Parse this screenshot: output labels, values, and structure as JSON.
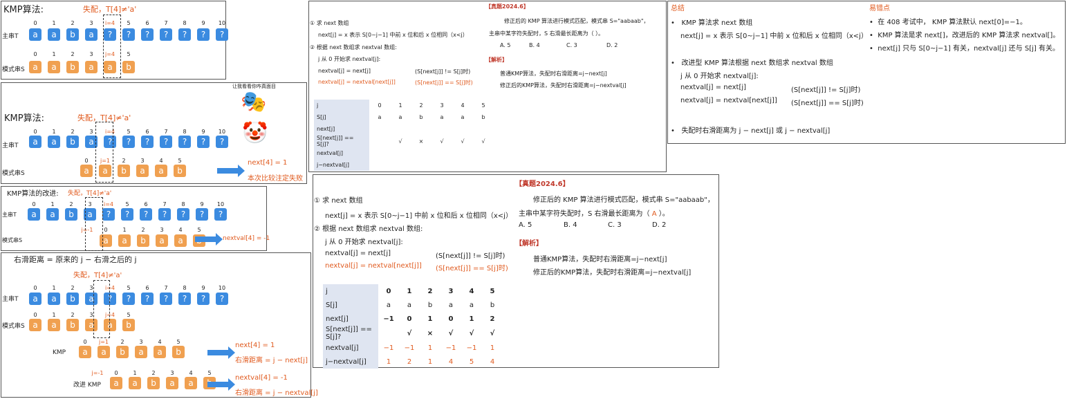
{
  "p1": {
    "title": "KMP算法:",
    "mismatch": "失配，T[4]≠'a'",
    "label_main": "主串T",
    "label_pattern": "模式串S",
    "idx_main": [
      "0",
      "1",
      "2",
      "3",
      "i=4",
      "5",
      "6",
      "7",
      "8",
      "9",
      "10"
    ],
    "main": [
      "a",
      "a",
      "b",
      "a",
      "?",
      "?",
      "?",
      "?",
      "?",
      "?",
      "?"
    ],
    "idx_pat": [
      "0",
      "1",
      "2",
      "3",
      "j=4",
      "5"
    ],
    "pattern": [
      "a",
      "a",
      "b",
      "a",
      "a",
      "b"
    ]
  },
  "p2": {
    "title": "KMP算法:",
    "mismatch": "失配，T[4]≠'a'",
    "caption": "让我看看你咋真面目",
    "label_main": "主串T",
    "label_pattern": "模式串S",
    "idx_main": [
      "0",
      "1",
      "2",
      "3",
      "i=4",
      "5",
      "6",
      "7",
      "8",
      "9",
      "10"
    ],
    "main": [
      "a",
      "a",
      "b",
      "a",
      "?",
      "?",
      "?",
      "?",
      "?",
      "?",
      "?"
    ],
    "idx_pat": [
      "0",
      "j=1",
      "2",
      "3",
      "4",
      "5"
    ],
    "pattern": [
      "a",
      "a",
      "b",
      "a",
      "a",
      "b"
    ],
    "note1": "next[4] = 1",
    "note2": "本次比较注定失败"
  },
  "p3": {
    "title": "KMP算法的改进:",
    "mismatch": "失配，T[4]≠'a'",
    "label_main": "主串T",
    "label_pattern": "模式串S",
    "idx_main": [
      "0",
      "1",
      "2",
      "3",
      "i=4",
      "5",
      "6",
      "7",
      "8",
      "9",
      "10"
    ],
    "main": [
      "a",
      "a",
      "b",
      "a",
      "?",
      "?",
      "?",
      "?",
      "?",
      "?",
      "?"
    ],
    "idx_pat": [
      "j=-1",
      "0",
      "1",
      "2",
      "3",
      "4",
      "5"
    ],
    "pattern": [
      "a",
      "a",
      "b",
      "a",
      "a",
      "b"
    ],
    "note": "nextval[4] = -1"
  },
  "p4": {
    "title": "右滑距离 = 原来的 j − 右滑之后的 j",
    "mismatch": "失配，T[4]≠'a'",
    "label_main": "主串T",
    "label_pattern": "模式串S",
    "idx_main": [
      "0",
      "1",
      "2",
      "3",
      "i=4",
      "5",
      "6",
      "7",
      "8",
      "9",
      "10"
    ],
    "main": [
      "a",
      "a",
      "b",
      "a",
      "?",
      "?",
      "?",
      "?",
      "?",
      "?",
      "?"
    ],
    "idx_pat": [
      "0",
      "1",
      "2",
      "3",
      "j=4",
      "5"
    ],
    "pattern": [
      "a",
      "a",
      "b",
      "a",
      "a",
      "b"
    ],
    "kmp_label": "KMP",
    "idx_kmp": [
      "0",
      "j=1",
      "2",
      "3",
      "4",
      "5"
    ],
    "kmp_note1": "next[4] = 1",
    "kmp_note2": "右滑距离 = j − next[j]",
    "improved_label": "改进 KMP",
    "idx_imp": [
      "j=-1",
      "0",
      "1",
      "2",
      "3",
      "4",
      "5"
    ],
    "imp_note1": "nextval[4] = -1",
    "imp_note2": "右滑距离 = j − nextval[j]"
  },
  "q": {
    "step1": "① 求 next 数组",
    "step1_def": "next[j] = x 表示 S[0~j−1] 中前 x 位和后 x 位相同（x<j）",
    "step2": "② 根据 next 数组求 nextval 数组:",
    "step2_sub": "j 从 0 开始求 nextval[j]:",
    "f1": "nextval[j] = next[j]",
    "c1": "(S[next[j]] != S[j]时)",
    "f2": "nextval[j] = nextval[next[j]]",
    "c2": "(S[next[j]] == S[j]时)",
    "tag": "【真题2024.6】",
    "question": "修正后的 KMP 算法进行模式匹配，模式串 S=\"aabaab\"，",
    "question2": "主串中某字符失配时，S 右滑最长距离为（    ）。",
    "options": [
      "A. 5",
      "B.  4",
      "C. 3",
      "D. 2"
    ],
    "analysis": "【解析】",
    "a1": "普通KMP算法，失配时右滑距离=j−next[j]",
    "a2": "修正后的KMP算法，失配时右滑距离=j−nextval[j]",
    "rows": [
      "j",
      "S[j]",
      "next[j]",
      "S[next[j]] == S[j]?",
      "nextval[j]",
      "j−nextval[j]"
    ],
    "j": [
      "0",
      "1",
      "2",
      "3",
      "4",
      "5"
    ],
    "S": [
      "a",
      "a",
      "b",
      "a",
      "a",
      "b"
    ],
    "cmp": [
      "",
      "√",
      "×",
      "√",
      "√",
      "√"
    ]
  },
  "q2": {
    "answer": "A",
    "next": [
      "−1",
      "0",
      "1",
      "0",
      "1",
      "2"
    ],
    "nextval": [
      "−1",
      "−1",
      "1",
      "−1",
      "−1",
      "1"
    ],
    "dist": [
      "1",
      "2",
      "1",
      "4",
      "5",
      "4"
    ]
  },
  "summary": {
    "title": "总结",
    "b1": "KMP 算法求 next 数组",
    "b1_def": "next[j] = x 表示 S[0~j−1] 中前 x 位和后 x 位相同（x<j）",
    "b2": "改进型 KMP 算法根据 next 数组求 nextval 数组",
    "b2_sub": "j 从 0 开始求 nextval[j]:",
    "f1": "nextval[j] = next[j]",
    "c1": "(S[next[j]] != S[j]时)",
    "f2": "nextval[j] = nextval[next[j]]",
    "c2": "(S[next[j]] == S[j]时)",
    "b3": "失配时右滑距离为 j − next[j] 或 j − nextval[j]",
    "err_title": "易错点",
    "e1": "在 408 考试中， KMP 算法默认 next[0]=−1。",
    "e2": "KMP 算法是求 next[]，改进后的 KMP 算法求 nextval[]。",
    "e3": "next[j] 只与 S[0~j−1] 有关，nextval[j] 还与 S[j] 有关。"
  }
}
